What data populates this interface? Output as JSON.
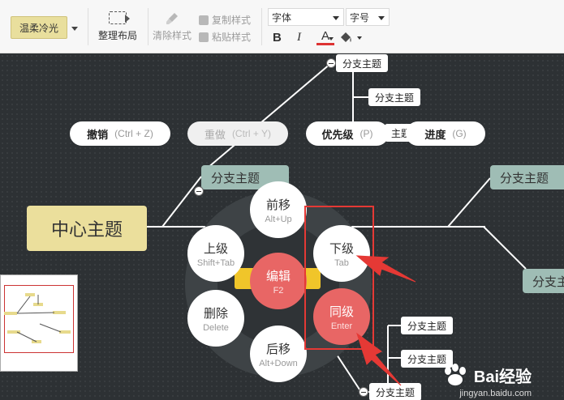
{
  "toolbar": {
    "theme": "温柔冷光",
    "arrange": "整理布局",
    "clear_style": "清除样式",
    "copy_style": "复制样式",
    "paste_style": "粘贴样式",
    "font": "字体",
    "size": "字号",
    "bold": "B",
    "italic": "I",
    "font_color": "A"
  },
  "mindmap": {
    "center": "中心主题",
    "main_left": "分支主题",
    "main_right_1": "分支主题",
    "main_right_2": "分支主",
    "sub_top_1": "分支主题",
    "sub_top_2": "分支主题",
    "sub_top_3": "主题",
    "sub_bottom_1": "分支主题",
    "sub_bottom_2": "分支主题",
    "sub_bottom_3": "分支主题"
  },
  "actions": {
    "undo": "撤销",
    "undo_key": "(Ctrl + Z)",
    "redo": "重做",
    "redo_key": "(Ctrl + Y)",
    "priority": "优先级",
    "priority_key": "(P)",
    "progress": "进度",
    "progress_key": "(G)"
  },
  "wheel": {
    "forward": "前移",
    "forward_key": "Alt+Up",
    "up": "上级",
    "up_key": "Shift+Tab",
    "down": "下级",
    "down_key": "Tab",
    "edit": "编辑",
    "edit_key": "F2",
    "sibling": "同级",
    "sibling_key": "Enter",
    "delete": "删除",
    "delete_key": "Delete",
    "backward": "后移",
    "backward_key": "Alt+Down"
  },
  "watermark": {
    "brand": "Bai经验",
    "url": "jingyan.baidu.com"
  },
  "colors": {
    "wheel_red": "#e86665",
    "center": "#ebdf9c",
    "branch": "#9fbdb5",
    "highlight": "#e53935"
  }
}
